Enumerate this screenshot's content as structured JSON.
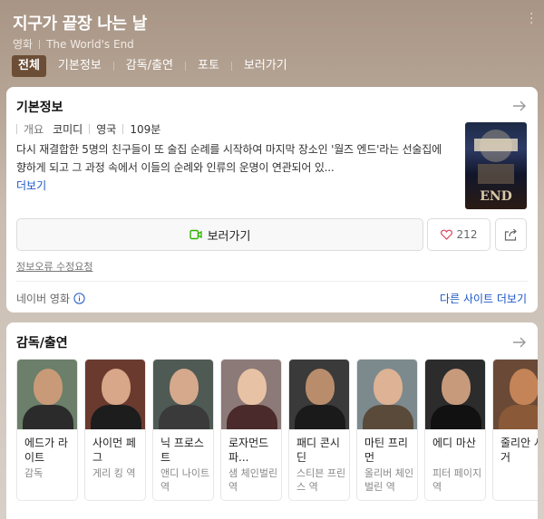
{
  "header": {
    "title": "지구가 끝장 나는 날",
    "category": "영화",
    "english_title": "The World's End",
    "tabs": [
      {
        "label": "전체",
        "active": true
      },
      {
        "label": "기본정보",
        "active": false
      },
      {
        "label": "감독/출연",
        "active": false
      },
      {
        "label": "포토",
        "active": false
      },
      {
        "label": "보러가기",
        "active": false
      }
    ]
  },
  "basic_info": {
    "title": "기본정보",
    "overview_label": "개요",
    "genre": "코미디",
    "country": "영국",
    "runtime": "109분",
    "synopsis": "다시 재결합한 5명의 친구들이 또 술집 순례를 시작하여 마지막 장소인 '월즈 엔드'라는 선술집에 향하게 되고 그 과정 속에서 이들의 순례와 인류의 운명이 연관되어 있...",
    "more_label": "더보기",
    "watch_label": "보러가기",
    "like_count": "212",
    "report_label": "정보오류 수정요청",
    "source_label": "네이버 영화",
    "other_sites_label": "다른 사이트 더보기"
  },
  "cast": {
    "title": "감독/출연",
    "members": [
      {
        "name": "에드가 라이트",
        "role": "감독"
      },
      {
        "name": "사이먼 페그",
        "role": "게리 킹 역"
      },
      {
        "name": "닉 프로스트",
        "role": "앤디 나이트 역"
      },
      {
        "name": "로자먼드 파...",
        "role": "샘 체인벌린 역"
      },
      {
        "name": "패디 콘시딘",
        "role": "스티븐 프린스 역"
      },
      {
        "name": "마틴 프리먼",
        "role": "올리버 체인벌린 역"
      },
      {
        "name": "에디 마산",
        "role": "피터 페이지 역"
      },
      {
        "name": "줄리안 시거",
        "role": ""
      }
    ]
  },
  "colors": {
    "header_bg": "#a89585",
    "active_tab": "#6b4e35",
    "link_blue": "#1a56c7",
    "watch_icon_green": "#2db400",
    "heart_red": "#e0425a"
  }
}
